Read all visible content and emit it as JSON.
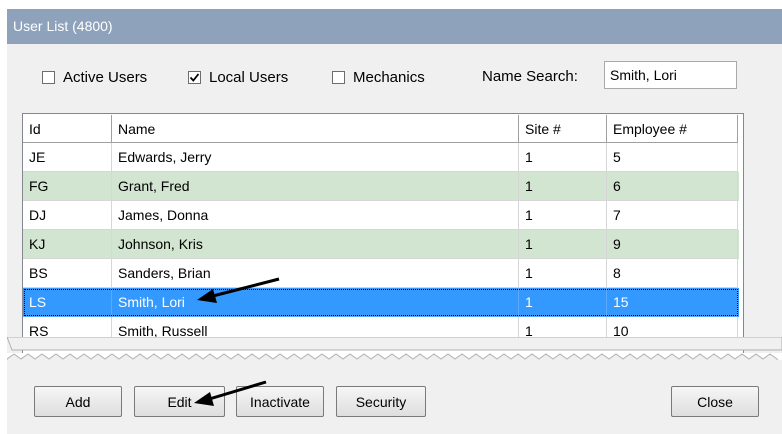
{
  "window": {
    "title": "User List (4800)"
  },
  "filters": {
    "active_users": {
      "label": "Active Users",
      "checked": false
    },
    "local_users": {
      "label": "Local Users",
      "checked": true
    },
    "mechanics": {
      "label": "Mechanics",
      "checked": false
    },
    "name_search_label": "Name Search:",
    "name_search_value": "Smith, Lori"
  },
  "table": {
    "columns": [
      "Id",
      "Name",
      "Site #",
      "Employee #"
    ],
    "rows": [
      {
        "id": "JE",
        "name": "Edwards, Jerry",
        "site": "1",
        "employee": "5",
        "style": "plain"
      },
      {
        "id": "FG",
        "name": "Grant, Fred",
        "site": "1",
        "employee": "6",
        "style": "local"
      },
      {
        "id": "DJ",
        "name": "James, Donna",
        "site": "1",
        "employee": "7",
        "style": "plain"
      },
      {
        "id": "KJ",
        "name": "Johnson, Kris",
        "site": "1",
        "employee": "9",
        "style": "local"
      },
      {
        "id": "BS",
        "name": "Sanders, Brian",
        "site": "1",
        "employee": "8",
        "style": "plain"
      },
      {
        "id": "LS",
        "name": "Smith, Lori",
        "site": "1",
        "employee": "15",
        "style": "selected"
      },
      {
        "id": "RS",
        "name": "Smith, Russell",
        "site": "1",
        "employee": "10",
        "style": "plain"
      }
    ]
  },
  "buttons": {
    "add": "Add",
    "edit": "Edit",
    "inactivate": "Inactivate",
    "security": "Security",
    "close": "Close"
  },
  "colors": {
    "title_bar": "#8ea2bb",
    "local_row": "#d2e5d0",
    "selected_row": "#3399ff",
    "window_bg": "#f0f0f0"
  }
}
